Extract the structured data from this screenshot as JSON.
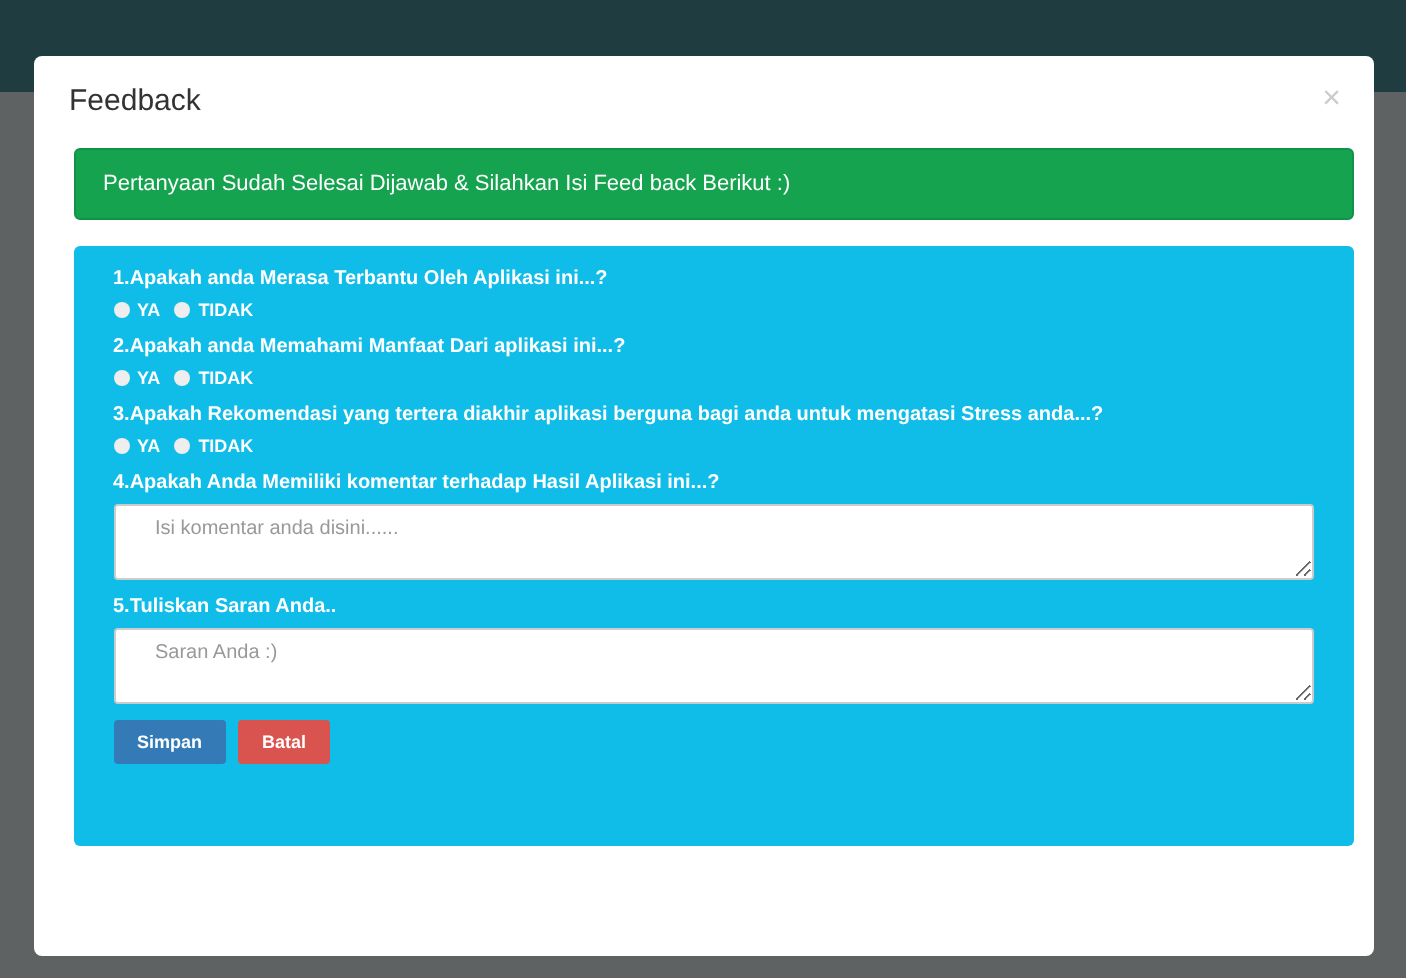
{
  "modal": {
    "title": "Feedback",
    "close": "×"
  },
  "alert": {
    "text": "Pertanyaan Sudah Selesai Dijawab & Silahkan Isi Feed back Berikut :)"
  },
  "questions": [
    {
      "kind": "radio",
      "label": "1.Apakah anda Merasa Terbantu Oleh Aplikasi ini...?",
      "options": [
        {
          "label": "YA",
          "checked": false
        },
        {
          "label": "TIDAK",
          "checked": false
        }
      ]
    },
    {
      "kind": "radio",
      "label": "2.Apakah anda Memahami Manfaat Dari aplikasi ini...?",
      "options": [
        {
          "label": "YA",
          "checked": false
        },
        {
          "label": "TIDAK",
          "checked": false
        }
      ]
    },
    {
      "kind": "radio",
      "label": "3.Apakah Rekomendasi yang tertera diakhir aplikasi berguna bagi anda untuk mengatasi Stress anda...?",
      "options": [
        {
          "label": "YA",
          "checked": false
        },
        {
          "label": "TIDAK",
          "checked": false
        }
      ]
    },
    {
      "kind": "text",
      "label": "4.Apakah Anda Memiliki komentar terhadap Hasil Aplikasi ini...?",
      "placeholder": "Isi komentar anda disini......"
    },
    {
      "kind": "text",
      "label": "5.Tuliskan Saran Anda..",
      "placeholder": "Saran Anda :)"
    }
  ],
  "buttons": [
    {
      "kind": "primary",
      "label": "Simpan"
    },
    {
      "kind": "danger",
      "label": "Batal"
    }
  ]
}
